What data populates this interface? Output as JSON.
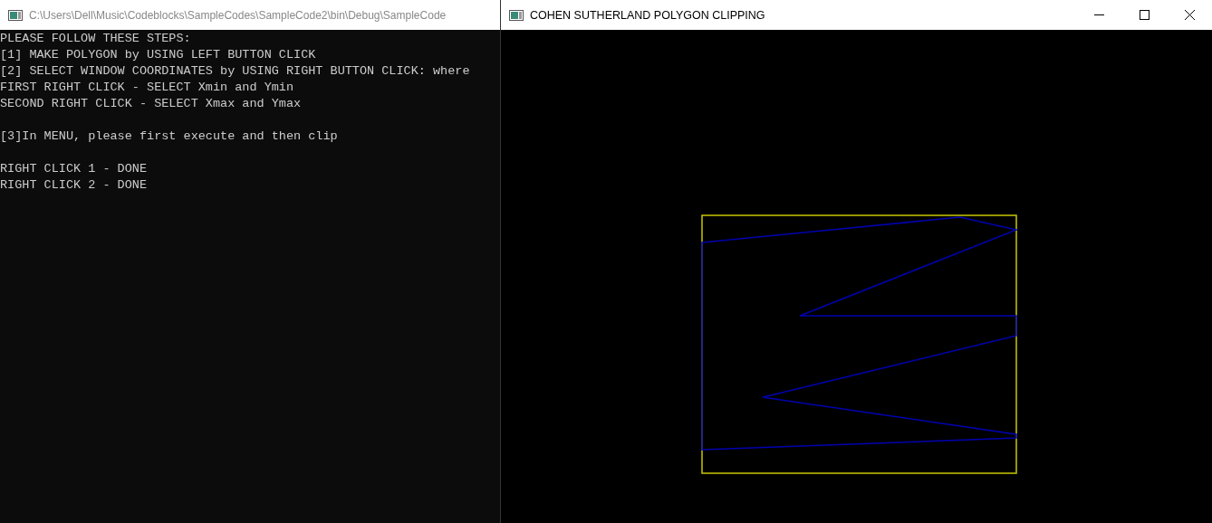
{
  "console_window": {
    "title": "C:\\Users\\Dell\\Music\\Codeblocks\\SampleCodes\\SampleCode2\\bin\\Debug\\SampleCode",
    "output_blocks": [
      [
        "PLEASE FOLLOW THESE STEPS:",
        "[1] MAKE POLYGON by USING LEFT BUTTON CLICK",
        "[2] SELECT WINDOW COORDINATES by USING RIGHT BUTTON CLICK: where",
        "FIRST RIGHT CLICK - SELECT Xmin and Ymin",
        "SECOND RIGHT CLICK - SELECT Xmax and Ymax"
      ],
      [
        "[3]In MENU, please first execute and then clip"
      ],
      [
        "RIGHT CLICK 1 - DONE",
        "RIGHT CLICK 2 - DONE"
      ]
    ]
  },
  "graphics_window": {
    "title": "COHEN SUTHERLAND POLYGON CLIPPING"
  }
}
